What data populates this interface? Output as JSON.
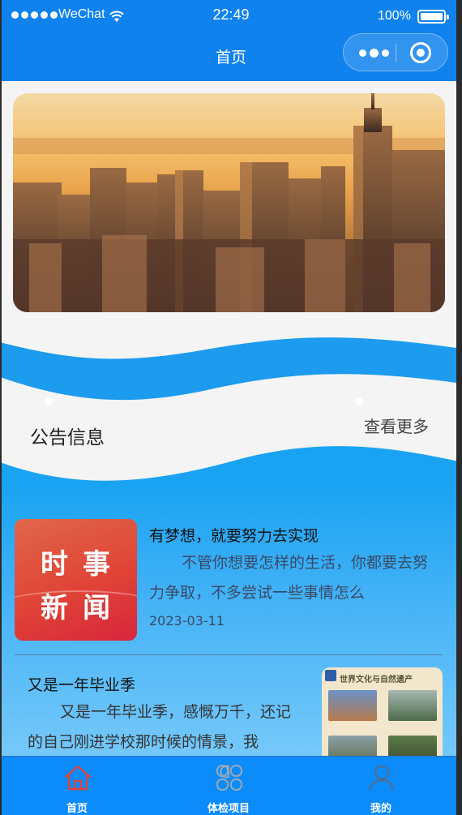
{
  "status_bar": {
    "carrier": "WeChat",
    "time": "22:49",
    "battery": "100%"
  },
  "nav": {
    "title": "首页"
  },
  "notice": {
    "title": "公告信息",
    "more": "查看更多"
  },
  "news": [
    {
      "thumb_text": [
        "时",
        "事",
        "新",
        "闻"
      ],
      "headline": "有梦想，就要努力去实现",
      "snippet": "不管你想要怎样的生活，你都要去努力争取，不多尝试一些事情怎么",
      "date": "2023-03-11"
    },
    {
      "thumb_title": "世界文化与自然遗产",
      "headline": "又是一年毕业季",
      "snippet": "又是一年毕业季，感慨万千，还记的自己刚进学校那时候的情景，我"
    }
  ],
  "tabs": [
    {
      "label": "首页",
      "icon": "home-icon",
      "active": true
    },
    {
      "label": "体检项目",
      "icon": "grid-icon",
      "active": false
    },
    {
      "label": "我的",
      "icon": "user-icon",
      "active": false
    }
  ],
  "colors": {
    "primary": "#1082ee",
    "tabbar": "#0c8bfa",
    "active_icon": "#e0443a"
  }
}
